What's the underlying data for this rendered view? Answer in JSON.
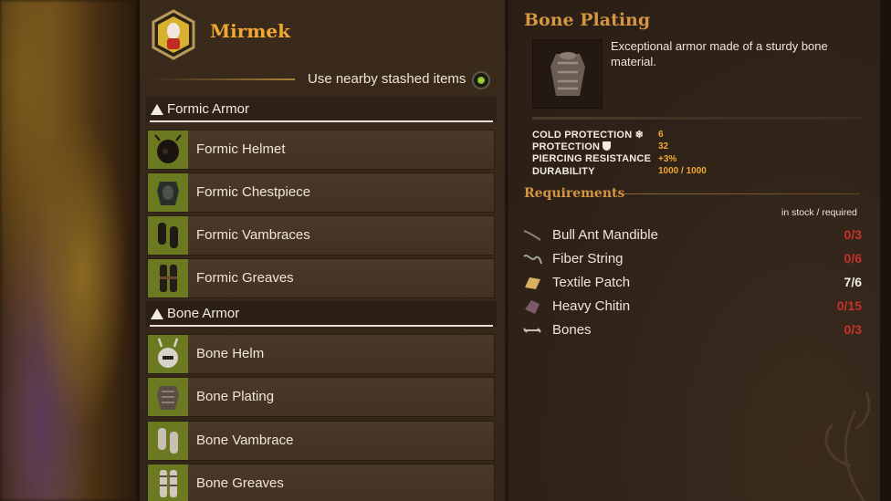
{
  "player": {
    "name": "Mirmek"
  },
  "stash": {
    "label": "Use nearby stashed items",
    "enabled": true
  },
  "categories": [
    {
      "label": "Formic Armor",
      "items": [
        {
          "label": "Formic Helmet",
          "icon": "formic-helmet-icon"
        },
        {
          "label": "Formic Chestpiece",
          "icon": "formic-chestpiece-icon"
        },
        {
          "label": "Formic Vambraces",
          "icon": "formic-vambraces-icon"
        },
        {
          "label": "Formic Greaves",
          "icon": "formic-greaves-icon"
        }
      ]
    },
    {
      "label": "Bone Armor",
      "items": [
        {
          "label": "Bone Helm",
          "icon": "bone-helm-icon"
        },
        {
          "label": "Bone Plating",
          "icon": "bone-plating-icon"
        },
        {
          "label": "Bone Vambrace",
          "icon": "bone-vambrace-icon"
        },
        {
          "label": "Bone Greaves",
          "icon": "bone-greaves-icon"
        }
      ]
    }
  ],
  "detail": {
    "title": "Bone Plating",
    "description": "Exceptional armor made of a sturdy bone material.",
    "stats": [
      {
        "name": "COLD PROTECTION",
        "icon": "snowflake-icon",
        "value": "6"
      },
      {
        "name": "PROTECTION",
        "icon": "shield-icon",
        "value": "32"
      },
      {
        "name": "PIERCING RESISTANCE",
        "icon": "",
        "value": "+3%"
      },
      {
        "name": "DURABILITY",
        "icon": "",
        "value": "1000 / 1000"
      }
    ]
  },
  "requirements": {
    "title": "Requirements",
    "note": "in stock / required",
    "items": [
      {
        "name": "Bull Ant Mandible",
        "count": "0/3",
        "status": "short",
        "icon": "mandible-icon"
      },
      {
        "name": "Fiber String",
        "count": "0/6",
        "status": "short",
        "icon": "string-icon"
      },
      {
        "name": "Textile Patch",
        "count": "7/6",
        "status": "ok",
        "icon": "patch-icon"
      },
      {
        "name": "Heavy Chitin",
        "count": "0/15",
        "status": "short",
        "icon": "chitin-icon"
      },
      {
        "name": "Bones",
        "count": "0/3",
        "status": "short",
        "icon": "bones-icon"
      }
    ]
  },
  "colors": {
    "accent": "#f0a830",
    "title": "#d49640",
    "shortage": "#c8322a",
    "thumb_bg": "#6b7a20"
  }
}
